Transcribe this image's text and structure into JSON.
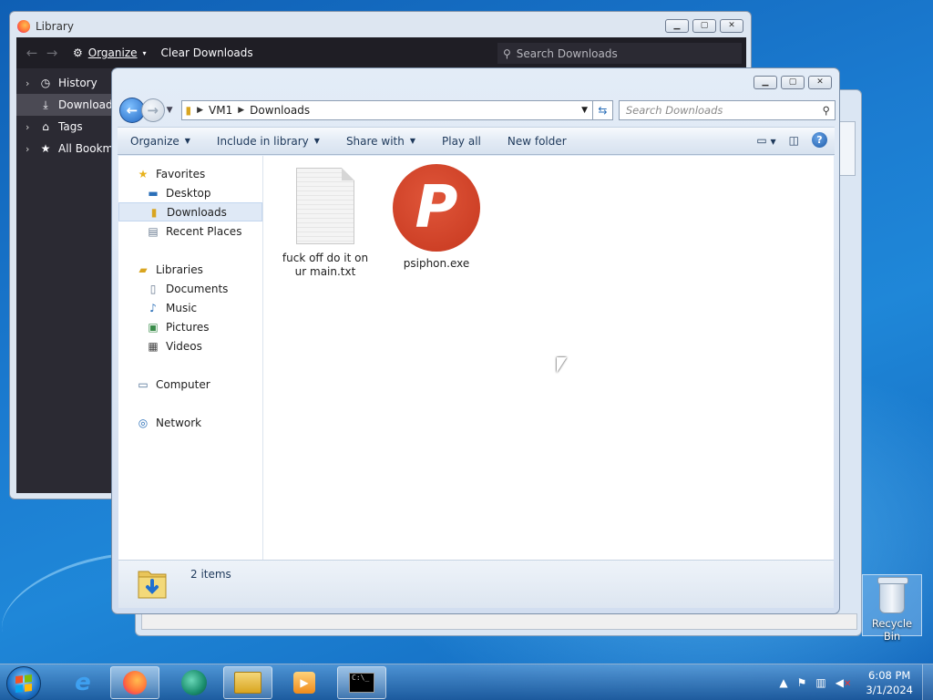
{
  "library": {
    "title": "Library",
    "organize_label": "Organize",
    "clear_label": "Clear Downloads",
    "search_placeholder": "Search Downloads",
    "sidebar": [
      {
        "label": "History"
      },
      {
        "label": "Downloads"
      },
      {
        "label": "Tags"
      },
      {
        "label": "All Bookma"
      }
    ]
  },
  "explorer": {
    "breadcrumb": [
      "VM1",
      "Downloads"
    ],
    "search_placeholder": "Search Downloads",
    "commands": [
      "Organize",
      "Include in library",
      "Share with",
      "Play all",
      "New folder"
    ],
    "nav": {
      "favorites": "Favorites",
      "favorites_items": [
        "Desktop",
        "Downloads",
        "Recent Places"
      ],
      "libraries": "Libraries",
      "libraries_items": [
        "Documents",
        "Music",
        "Pictures",
        "Videos"
      ],
      "computer": "Computer",
      "network": "Network"
    },
    "files": [
      {
        "name": "fuck off do it on ur main.txt"
      },
      {
        "name": "psiphon.exe"
      }
    ],
    "psiphon_glyph": "P",
    "status": "2 items"
  },
  "desktop": {
    "recycle_bin": "Recycle Bin"
  },
  "taskbar": {
    "time": "6:08 PM",
    "date": "3/1/2024"
  },
  "colors": {
    "accent": "#1f87d8",
    "psiphon": "#c6371e",
    "firefox_dark": "#1f1e25"
  }
}
